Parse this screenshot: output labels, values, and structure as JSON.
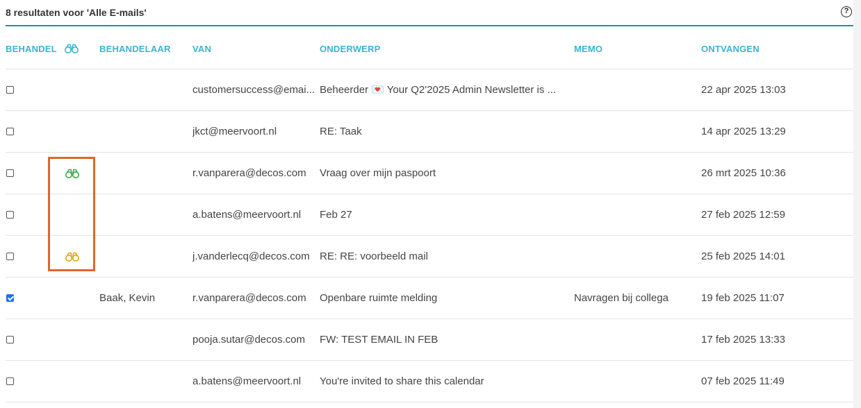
{
  "header": {
    "title": "8 resultaten voor 'Alle E-mails'",
    "help_glyph": "?"
  },
  "columns": {
    "behandel": "BEHANDEL",
    "behandelaar": "BEHANDELAAR",
    "van": "VAN",
    "onderwerp": "ONDERWERP",
    "memo": "MEMO",
    "ontvangen": "ONTVANGEN"
  },
  "colors": {
    "accent": "#3ab4d0",
    "header_rule": "#2a8aa6",
    "binoculars_header": "#3ab4d0",
    "binoculars_green": "#3aa84a",
    "binoculars_yellow": "#e8a317",
    "highlight_box": "#e0652b",
    "checkbox_checked": "#1a73e8"
  },
  "rows": [
    {
      "checked": false,
      "behandel_icon": "",
      "behandelaar": "",
      "van": "customersuccess@emai...",
      "onderwerp": "Beheerder 💌 Your Q2'2025 Admin Newsletter is ...",
      "memo": "",
      "ontvangen": "22 apr 2025 13:03"
    },
    {
      "checked": false,
      "behandel_icon": "",
      "behandelaar": "",
      "van": "jkct@meervoort.nl",
      "onderwerp": "RE: Taak",
      "memo": "",
      "ontvangen": "14 apr 2025 13:29"
    },
    {
      "checked": false,
      "behandel_icon": "binoculars-green",
      "behandelaar": "",
      "van": "r.vanparera@decos.com",
      "onderwerp": "Vraag over mijn paspoort",
      "memo": "",
      "ontvangen": "26 mrt 2025 10:36"
    },
    {
      "checked": false,
      "behandel_icon": "",
      "behandelaar": "",
      "van": "a.batens@meervoort.nl",
      "onderwerp": "Feb 27",
      "memo": "",
      "ontvangen": "27 feb 2025 12:59"
    },
    {
      "checked": false,
      "behandel_icon": "binoculars-yellow",
      "behandelaar": "",
      "van": "j.vanderlecq@decos.com",
      "onderwerp": "RE: RE: voorbeeld mail",
      "memo": "",
      "ontvangen": "25 feb 2025 14:01"
    },
    {
      "checked": true,
      "behandel_icon": "",
      "behandelaar": "Baak, Kevin",
      "van": "r.vanparera@decos.com",
      "onderwerp": "Openbare ruimte melding",
      "memo": "Navragen bij collega",
      "ontvangen": "19 feb 2025 11:07"
    },
    {
      "checked": false,
      "behandel_icon": "",
      "behandelaar": "",
      "van": "pooja.sutar@decos.com",
      "onderwerp": "FW: TEST EMAIL IN FEB",
      "memo": "",
      "ontvangen": "17 feb 2025 13:33"
    },
    {
      "checked": false,
      "behandel_icon": "",
      "behandelaar": "",
      "van": "a.batens@meervoort.nl",
      "onderwerp": "You're invited to share this calendar",
      "memo": "",
      "ontvangen": "07 feb 2025 11:49"
    }
  ]
}
